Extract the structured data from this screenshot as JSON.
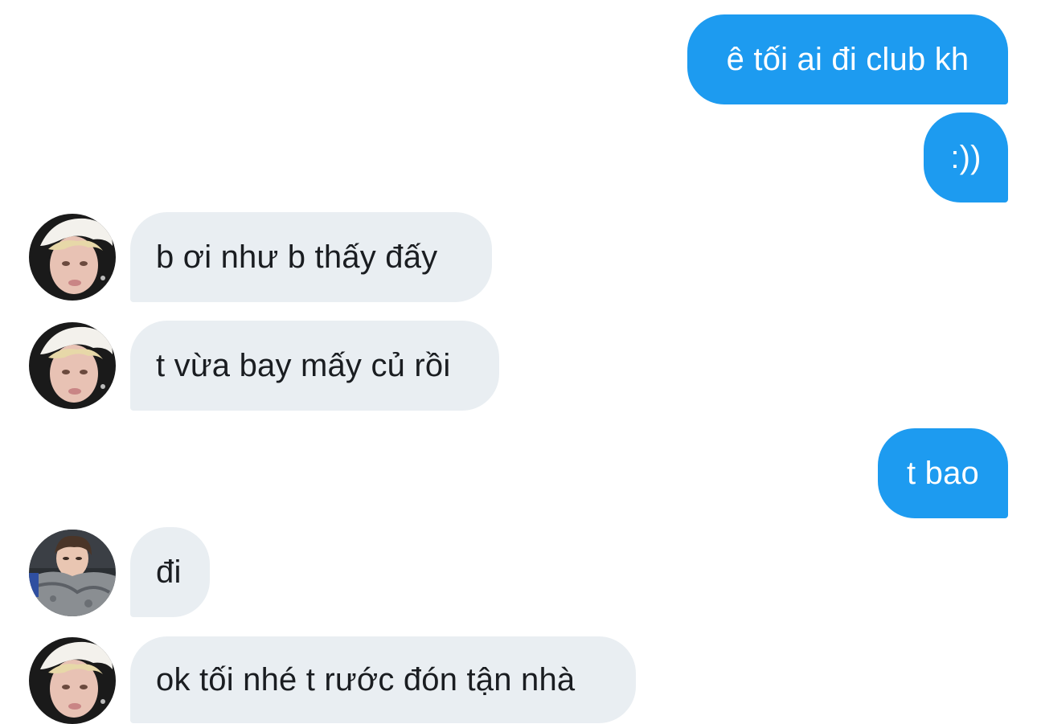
{
  "messages": [
    {
      "id": "m1",
      "direction": "outgoing",
      "text": "ê tối ai đi club kh"
    },
    {
      "id": "m2",
      "direction": "outgoing",
      "text": ":))"
    },
    {
      "id": "m3",
      "direction": "incoming",
      "avatar": "blond-hair-avatar",
      "text": "b ơi như b thấy đấy"
    },
    {
      "id": "m4",
      "direction": "incoming",
      "avatar": "blond-hair-avatar",
      "text": "t vừa bay mấy củ rồi"
    },
    {
      "id": "m5",
      "direction": "outgoing",
      "text": "t bao"
    },
    {
      "id": "m6",
      "direction": "incoming",
      "avatar": "dark-hair-avatar",
      "text": "đi"
    },
    {
      "id": "m7",
      "direction": "incoming",
      "avatar": "blond-hair-avatar",
      "text": "ok tối nhé t rước đón tận nhà"
    }
  ],
  "colors": {
    "outgoing_bubble": "#1d9bf0",
    "outgoing_text": "#ffffff",
    "incoming_bubble": "#e9eef2",
    "incoming_text": "#1a1d21",
    "background": "#ffffff"
  }
}
